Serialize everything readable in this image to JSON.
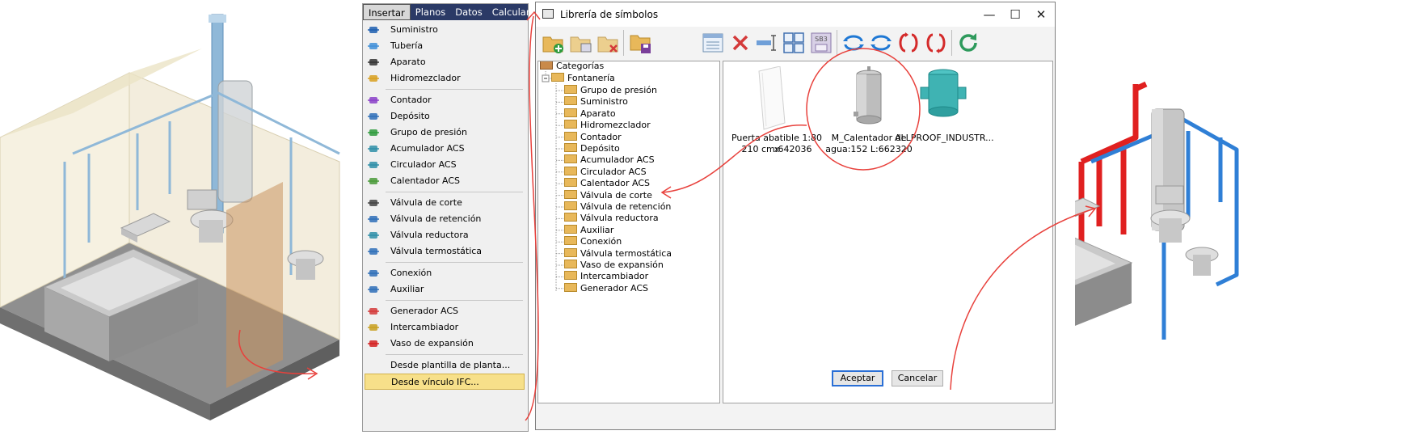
{
  "menu": {
    "bar": [
      "Insertar",
      "Planos",
      "Datos",
      "Calcular"
    ],
    "groups": [
      [
        {
          "label": "Suministro",
          "icon": "supply-icon"
        },
        {
          "label": "Tubería",
          "icon": "pipe-icon"
        },
        {
          "label": "Aparato",
          "icon": "fixture-icon"
        },
        {
          "label": "Hidromezclador",
          "icon": "mixer-icon"
        }
      ],
      [
        {
          "label": "Contador",
          "icon": "meter-icon"
        },
        {
          "label": "Depósito",
          "icon": "tank-icon"
        },
        {
          "label": "Grupo de presión",
          "icon": "pressure-group-icon"
        },
        {
          "label": "Acumulador ACS",
          "icon": "accumulator-icon"
        },
        {
          "label": "Circulador ACS",
          "icon": "circulator-icon"
        },
        {
          "label": "Calentador ACS",
          "icon": "heater-icon"
        }
      ],
      [
        {
          "label": "Válvula de corte",
          "icon": "shutoff-valve-icon"
        },
        {
          "label": "Válvula de retención",
          "icon": "check-valve-icon"
        },
        {
          "label": "Válvula reductora",
          "icon": "reducing-valve-icon"
        },
        {
          "label": "Válvula termostática",
          "icon": "thermostatic-valve-icon"
        }
      ],
      [
        {
          "label": "Conexión",
          "icon": "connection-icon"
        },
        {
          "label": "Auxiliar",
          "icon": "auxiliary-icon"
        }
      ],
      [
        {
          "label": "Generador ACS",
          "icon": "generator-icon"
        },
        {
          "label": "Intercambiador",
          "icon": "exchanger-icon"
        },
        {
          "label": "Vaso de expansión",
          "icon": "expansion-vessel-icon"
        }
      ],
      [
        {
          "label": "Desde plantilla de planta...",
          "icon": ""
        },
        {
          "label": "Desde vínculo IFC...",
          "icon": ""
        }
      ]
    ],
    "highlighted": "Desde vínculo IFC..."
  },
  "dialog": {
    "title": "Librería de símbolos",
    "window_buttons": [
      "—",
      "☐",
      "✕"
    ],
    "toolbar_icons": [
      "new-folder-icon",
      "folder-properties-icon",
      "delete-folder-icon",
      "save-folder-icon",
      "list-view-icon",
      "delete-icon",
      "measure-icon",
      "grid-view-icon",
      "sb3-icon",
      "rotate-left-icon",
      "rotate-right-icon",
      "flip-horizontal-icon",
      "flip-vertical-icon",
      "refresh-icon"
    ],
    "sb3_label": "SB3",
    "tree": {
      "root": "Categorías",
      "branch": "Fontanería",
      "children": [
        "Grupo de presión",
        "Suministro",
        "Aparato",
        "Hidromezclador",
        "Contador",
        "Depósito",
        "Acumulador ACS",
        "Circulador ACS",
        "Calentador ACS",
        "Válvula de corte",
        "Válvula de retención",
        "Válvula reductora",
        "Auxiliar",
        "Conexión",
        "Válvula termostática",
        "Vaso de expansión",
        "Intercambiador",
        "Generador ACS"
      ]
    },
    "symbols": [
      {
        "caption1": "Puerta abatible 1:80 x",
        "caption2": "210 cm:642036"
      },
      {
        "caption1": "M_Calentador de",
        "caption2": "agua:152 L:662320"
      },
      {
        "caption1": "ALLPROOF_INDUSTR...",
        "caption2": ""
      }
    ],
    "ok_label": "Aceptar",
    "cancel_label": "Cancelar"
  },
  "colors": {
    "menubar": "#2b3a66",
    "hot_pipe": "#e02020",
    "cold_pipe": "#2f7fd6",
    "annotation": "#e8413c",
    "highlight": "#f7e08a"
  }
}
